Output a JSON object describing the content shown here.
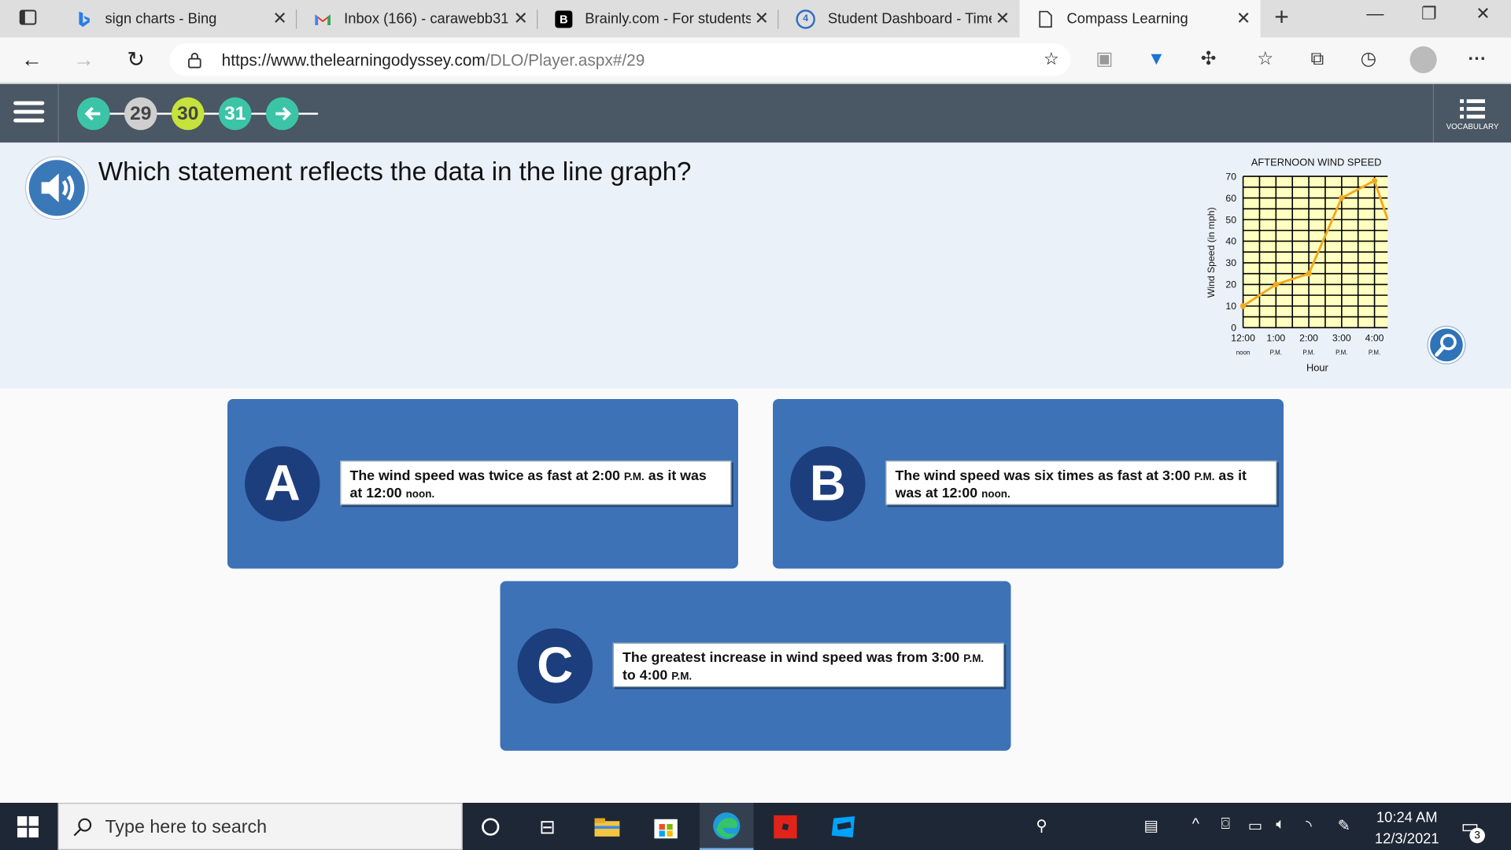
{
  "browser": {
    "tabs": [
      {
        "title": "sign charts - Bing",
        "icon": "bing-icon"
      },
      {
        "title": "Inbox (166) - carawebb31",
        "icon": "gmail-icon"
      },
      {
        "title": "Brainly.com - For students",
        "icon": "brainly-icon"
      },
      {
        "title": "Student Dashboard - Time",
        "icon": "dashboard-icon"
      },
      {
        "title": "Compass Learning",
        "icon": "page-icon"
      }
    ],
    "url_domain": "https://www.thelearningodyssey.com",
    "url_path": "/DLO/Player.aspx#/29"
  },
  "app": {
    "nav": {
      "prev": "29",
      "current": "30",
      "next": "31"
    },
    "vocab_label": "VOCABULARY",
    "question": "Which statement reflects the data in the line graph?"
  },
  "chart_data": {
    "type": "line",
    "title": "AFTERNOON WIND SPEED",
    "xlabel": "Hour",
    "ylabel": "Wind Speed (in mph)",
    "x_tick_labels": [
      "12:00",
      "1:00",
      "2:00",
      "3:00",
      "4:00"
    ],
    "x_tick_sublabels": [
      "noon",
      "P.M.",
      "P.M.",
      "P.M.",
      "P.M."
    ],
    "y_ticks": [
      0,
      10,
      20,
      30,
      40,
      50,
      60,
      70
    ],
    "ylim": [
      0,
      70
    ],
    "x_hours": [
      0,
      1,
      2,
      3,
      4,
      4.4
    ],
    "values": [
      10,
      20,
      25,
      60,
      68,
      50
    ],
    "grid": true,
    "colors": {
      "line": "#f2a91f",
      "plot_bg": "#ffffc0",
      "grid": "#000000"
    }
  },
  "answers": [
    {
      "letter": "A",
      "text": "The wind speed was twice as fast at 2:00",
      "small1": "P.M.",
      "text2": "as it was at 12:00",
      "small2": "noon."
    },
    {
      "letter": "B",
      "text": "The wind speed was six times as fast at 3:00",
      "small1": "P.M.",
      "text2": "as it was at 12:00",
      "small2": "noon."
    },
    {
      "letter": "C",
      "text": "The greatest increase in wind speed was from 3:00",
      "small1": "P.M.",
      "text2": "to 4:00",
      "small2": "P.M."
    }
  ],
  "taskbar": {
    "search_placeholder": "Type here to search",
    "time": "10:24 AM",
    "date": "12/3/2021",
    "notification_count": "3"
  }
}
